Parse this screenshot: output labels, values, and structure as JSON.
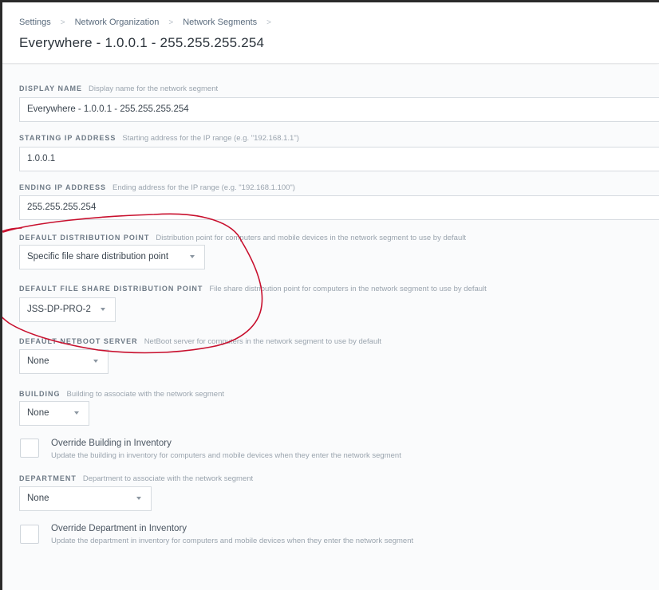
{
  "breadcrumb": {
    "items": [
      "Settings",
      "Network Organization",
      "Network Segments"
    ],
    "separator": ">"
  },
  "page": {
    "title": "Everywhere - 1.0.0.1 - 255.255.255.254"
  },
  "fields": {
    "display_name": {
      "label": "DISPLAY NAME",
      "description": "Display name for the network segment",
      "value": "Everywhere - 1.0.0.1 - 255.255.255.254"
    },
    "starting_ip": {
      "label": "STARTING IP ADDRESS",
      "description": "Starting address for the IP range (e.g. \"192.168.1.1\")",
      "value": "1.0.0.1"
    },
    "ending_ip": {
      "label": "ENDING IP ADDRESS",
      "description": "Ending address for the IP range (e.g. \"192.168.1.100\")",
      "value": "255.255.255.254"
    },
    "default_distribution_point": {
      "label": "DEFAULT DISTRIBUTION POINT",
      "description": "Distribution point for computers and mobile devices in the network segment to use by default",
      "value": "Specific file share distribution point"
    },
    "default_file_share_dp": {
      "label": "DEFAULT FILE SHARE DISTRIBUTION POINT",
      "description": "File share distribution point for computers in the network segment to use by default",
      "value": "JSS-DP-PRO-2"
    },
    "default_netboot_server": {
      "label": "DEFAULT NETBOOT SERVER",
      "description": "NetBoot server for computers in the network segment to use by default",
      "value": "None"
    },
    "building": {
      "label": "BUILDING",
      "description": "Building to associate with the network segment",
      "value": "None"
    },
    "override_building": {
      "title": "Override Building in Inventory",
      "description": "Update the building in inventory for computers and mobile devices when they enter the network segment",
      "checked": false
    },
    "department": {
      "label": "DEPARTMENT",
      "description": "Department to associate with the network segment",
      "value": "None"
    },
    "override_department": {
      "title": "Override Department in Inventory",
      "description": "Update the department in inventory for computers and mobile devices when they enter the network segment",
      "checked": false
    }
  },
  "icons": {
    "breadcrumb_separator": "chevron-right-icon",
    "dropdown": "caret-down-icon"
  },
  "colors": {
    "annotation": "#c8102e",
    "border": "#d6dbe0",
    "label": "#6e7a86"
  }
}
